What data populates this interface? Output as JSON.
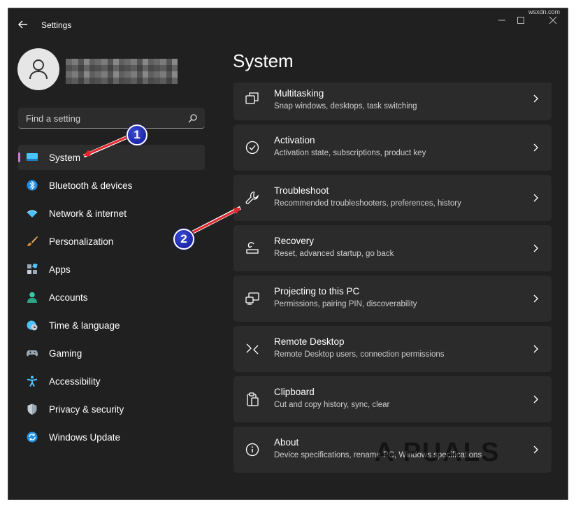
{
  "window": {
    "title": "Settings",
    "corner_text": "wsxdn.com"
  },
  "user": {
    "avatar_icon": "user-avatar-icon"
  },
  "search": {
    "placeholder": "Find a setting"
  },
  "sidebar": {
    "items": [
      {
        "label": "System",
        "icon": "monitor-icon",
        "active": true
      },
      {
        "label": "Bluetooth & devices",
        "icon": "bluetooth-icon"
      },
      {
        "label": "Network & internet",
        "icon": "wifi-icon"
      },
      {
        "label": "Personalization",
        "icon": "brush-icon"
      },
      {
        "label": "Apps",
        "icon": "apps-icon"
      },
      {
        "label": "Accounts",
        "icon": "person-icon"
      },
      {
        "label": "Time & language",
        "icon": "globe-clock-icon"
      },
      {
        "label": "Gaming",
        "icon": "gamepad-icon"
      },
      {
        "label": "Accessibility",
        "icon": "accessibility-icon"
      },
      {
        "label": "Privacy & security",
        "icon": "shield-icon"
      },
      {
        "label": "Windows Update",
        "icon": "update-icon"
      }
    ]
  },
  "main": {
    "title": "System",
    "cards": [
      {
        "title": "Multitasking",
        "subtitle": "Snap windows, desktops, task switching",
        "icon": "multitasking-icon"
      },
      {
        "title": "Activation",
        "subtitle": "Activation state, subscriptions, product key",
        "icon": "check-circle-icon"
      },
      {
        "title": "Troubleshoot",
        "subtitle": "Recommended troubleshooters, preferences, history",
        "icon": "wrench-icon"
      },
      {
        "title": "Recovery",
        "subtitle": "Reset, advanced startup, go back",
        "icon": "recovery-icon"
      },
      {
        "title": "Projecting to this PC",
        "subtitle": "Permissions, pairing PIN, discoverability",
        "icon": "projecting-icon"
      },
      {
        "title": "Remote Desktop",
        "subtitle": "Remote Desktop users, connection permissions",
        "icon": "remote-desktop-icon"
      },
      {
        "title": "Clipboard",
        "subtitle": "Cut and copy history, sync, clear",
        "icon": "clipboard-icon"
      },
      {
        "title": "About",
        "subtitle": "Device specifications, rename PC, Windows specifications",
        "icon": "info-icon"
      }
    ]
  },
  "annotations": {
    "step1": "1",
    "step2": "2"
  },
  "colors": {
    "accent": "#ca79d8",
    "window_bg": "#202020",
    "card_bg": "#2b2b2b",
    "arrow": "#e3262c",
    "badge": "#1d27a8"
  },
  "watermark": "A PUALS"
}
